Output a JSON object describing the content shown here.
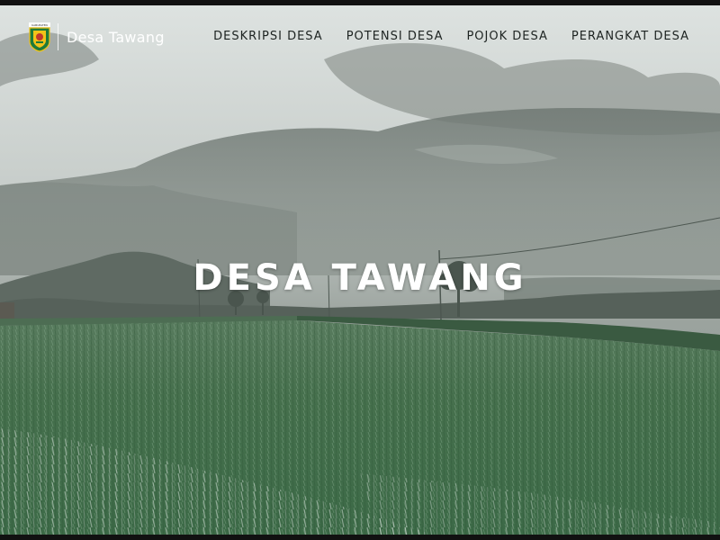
{
  "brand": {
    "name": "Desa Tawang",
    "logo_icon": "village-emblem-icon",
    "logo_caption": "KABUPATEN"
  },
  "nav": {
    "items": [
      {
        "label": "DESKRIPSI DESA"
      },
      {
        "label": "POTENSI DESA"
      },
      {
        "label": "POJOK DESA"
      },
      {
        "label": "PERANGKAT DESA"
      }
    ]
  },
  "hero": {
    "title": "DESA TAWANG",
    "background": "misty-rice-field-photo"
  },
  "colors": {
    "nav_text": "#1d2321",
    "title_text": "#ffffff",
    "field_green": "#3f6b48",
    "sky": "#c9cfcd"
  }
}
